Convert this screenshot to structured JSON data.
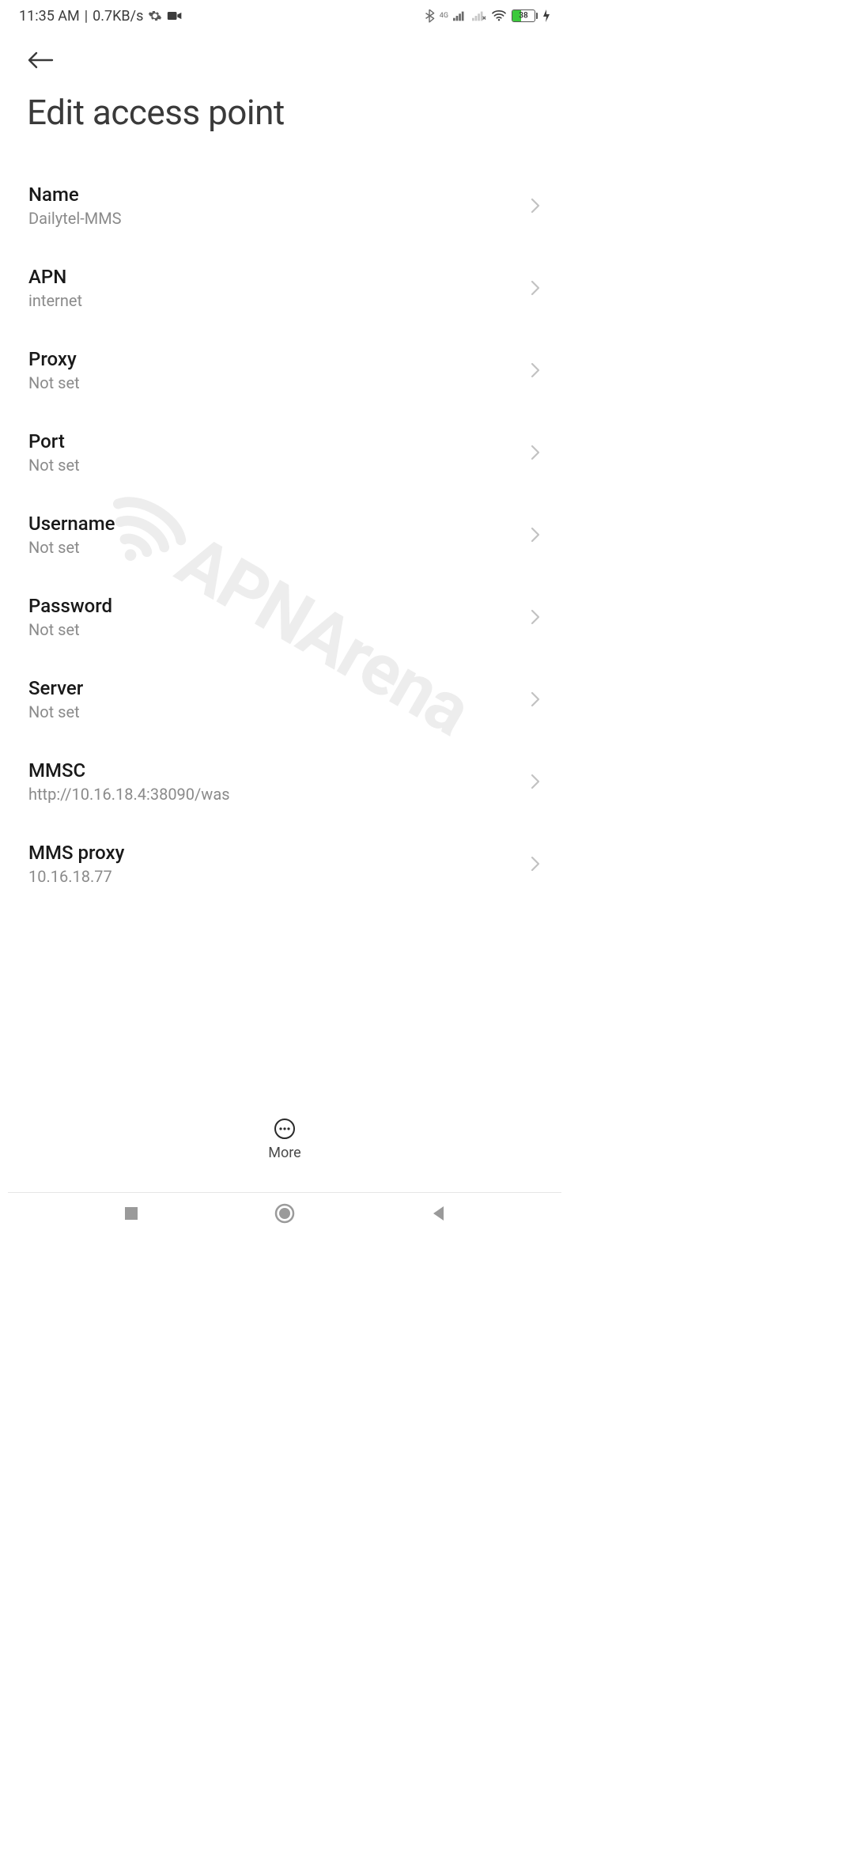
{
  "status": {
    "time": "11:35 AM",
    "speed": "0.7KB/s",
    "battery_percent": "38"
  },
  "header": {
    "title": "Edit access point"
  },
  "rows": [
    {
      "label": "Name",
      "value": "Dailytel-MMS"
    },
    {
      "label": "APN",
      "value": "internet"
    },
    {
      "label": "Proxy",
      "value": "Not set"
    },
    {
      "label": "Port",
      "value": "Not set"
    },
    {
      "label": "Username",
      "value": "Not set"
    },
    {
      "label": "Password",
      "value": "Not set"
    },
    {
      "label": "Server",
      "value": "Not set"
    },
    {
      "label": "MMSC",
      "value": "http://10.16.18.4:38090/was"
    },
    {
      "label": "MMS proxy",
      "value": "10.16.18.77"
    }
  ],
  "bottom": {
    "more_label": "More"
  },
  "watermark": {
    "text": "APNArena"
  }
}
